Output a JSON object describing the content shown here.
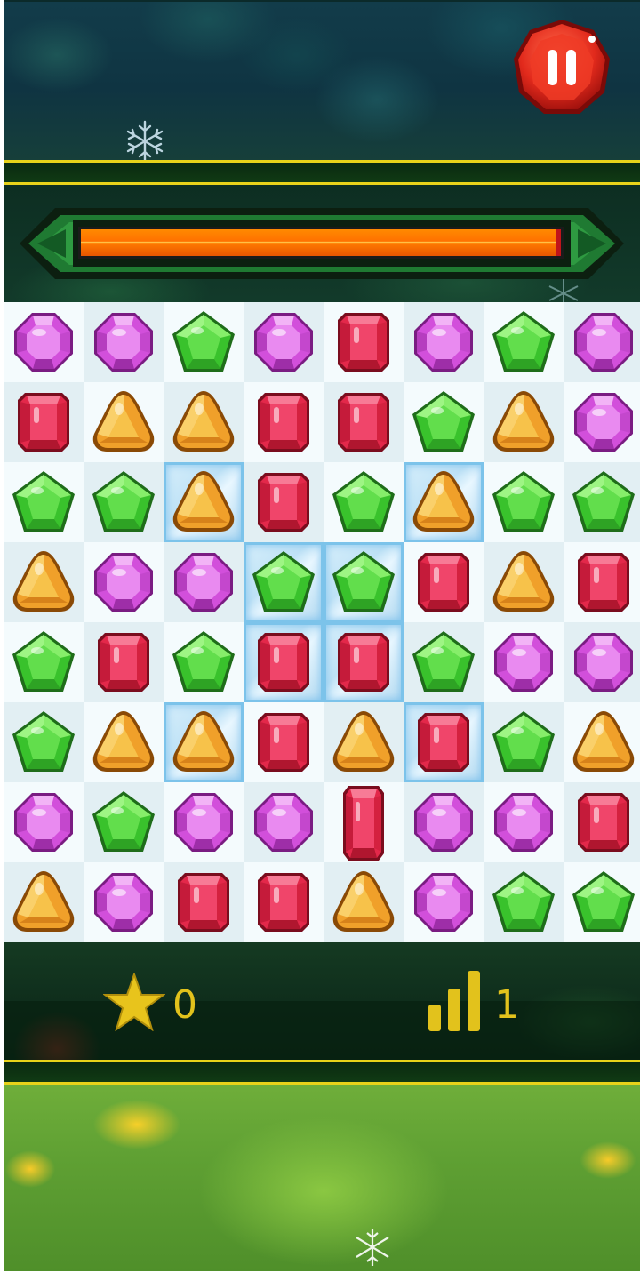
{
  "hud": {
    "score": "0",
    "level": "1",
    "progress_fraction": 0.99
  },
  "icons": {
    "pause": "pause-icon",
    "score": "star-icon",
    "level": "signal-bars-icon",
    "decor": "snowflake-icon"
  },
  "colors": {
    "accent_gold": "#e2c21c",
    "bar_border": "#e8d21a",
    "pause_red": "#e22a1c",
    "progress_fill": "#ff7a00",
    "progress_track": "#c0151b"
  },
  "board": {
    "rows": 8,
    "cols": 8,
    "gems": [
      [
        "purple",
        "purple",
        "green",
        "purple",
        "red",
        "purple",
        "green",
        "purple"
      ],
      [
        "red",
        "orange",
        "orange",
        "red",
        "red",
        "green",
        "orange",
        "purple"
      ],
      [
        "green",
        "green",
        "orange",
        "red",
        "green",
        "orange",
        "green",
        "green"
      ],
      [
        "orange",
        "purple",
        "purple",
        "green",
        "green",
        "red",
        "orange",
        "red"
      ],
      [
        "green",
        "red",
        "green",
        "red",
        "red",
        "green",
        "purple",
        "purple"
      ],
      [
        "green",
        "orange",
        "orange",
        "red",
        "orange",
        "red",
        "green",
        "orange"
      ],
      [
        "purple",
        "green",
        "purple",
        "purple",
        "red-tall",
        "purple",
        "purple",
        "red"
      ],
      [
        "orange",
        "purple",
        "red",
        "red",
        "orange",
        "purple",
        "green",
        "green"
      ]
    ],
    "ice": [
      [
        2,
        2
      ],
      [
        2,
        5
      ],
      [
        3,
        3
      ],
      [
        3,
        4
      ],
      [
        4,
        3
      ],
      [
        4,
        4
      ],
      [
        5,
        2
      ],
      [
        5,
        5
      ]
    ]
  }
}
